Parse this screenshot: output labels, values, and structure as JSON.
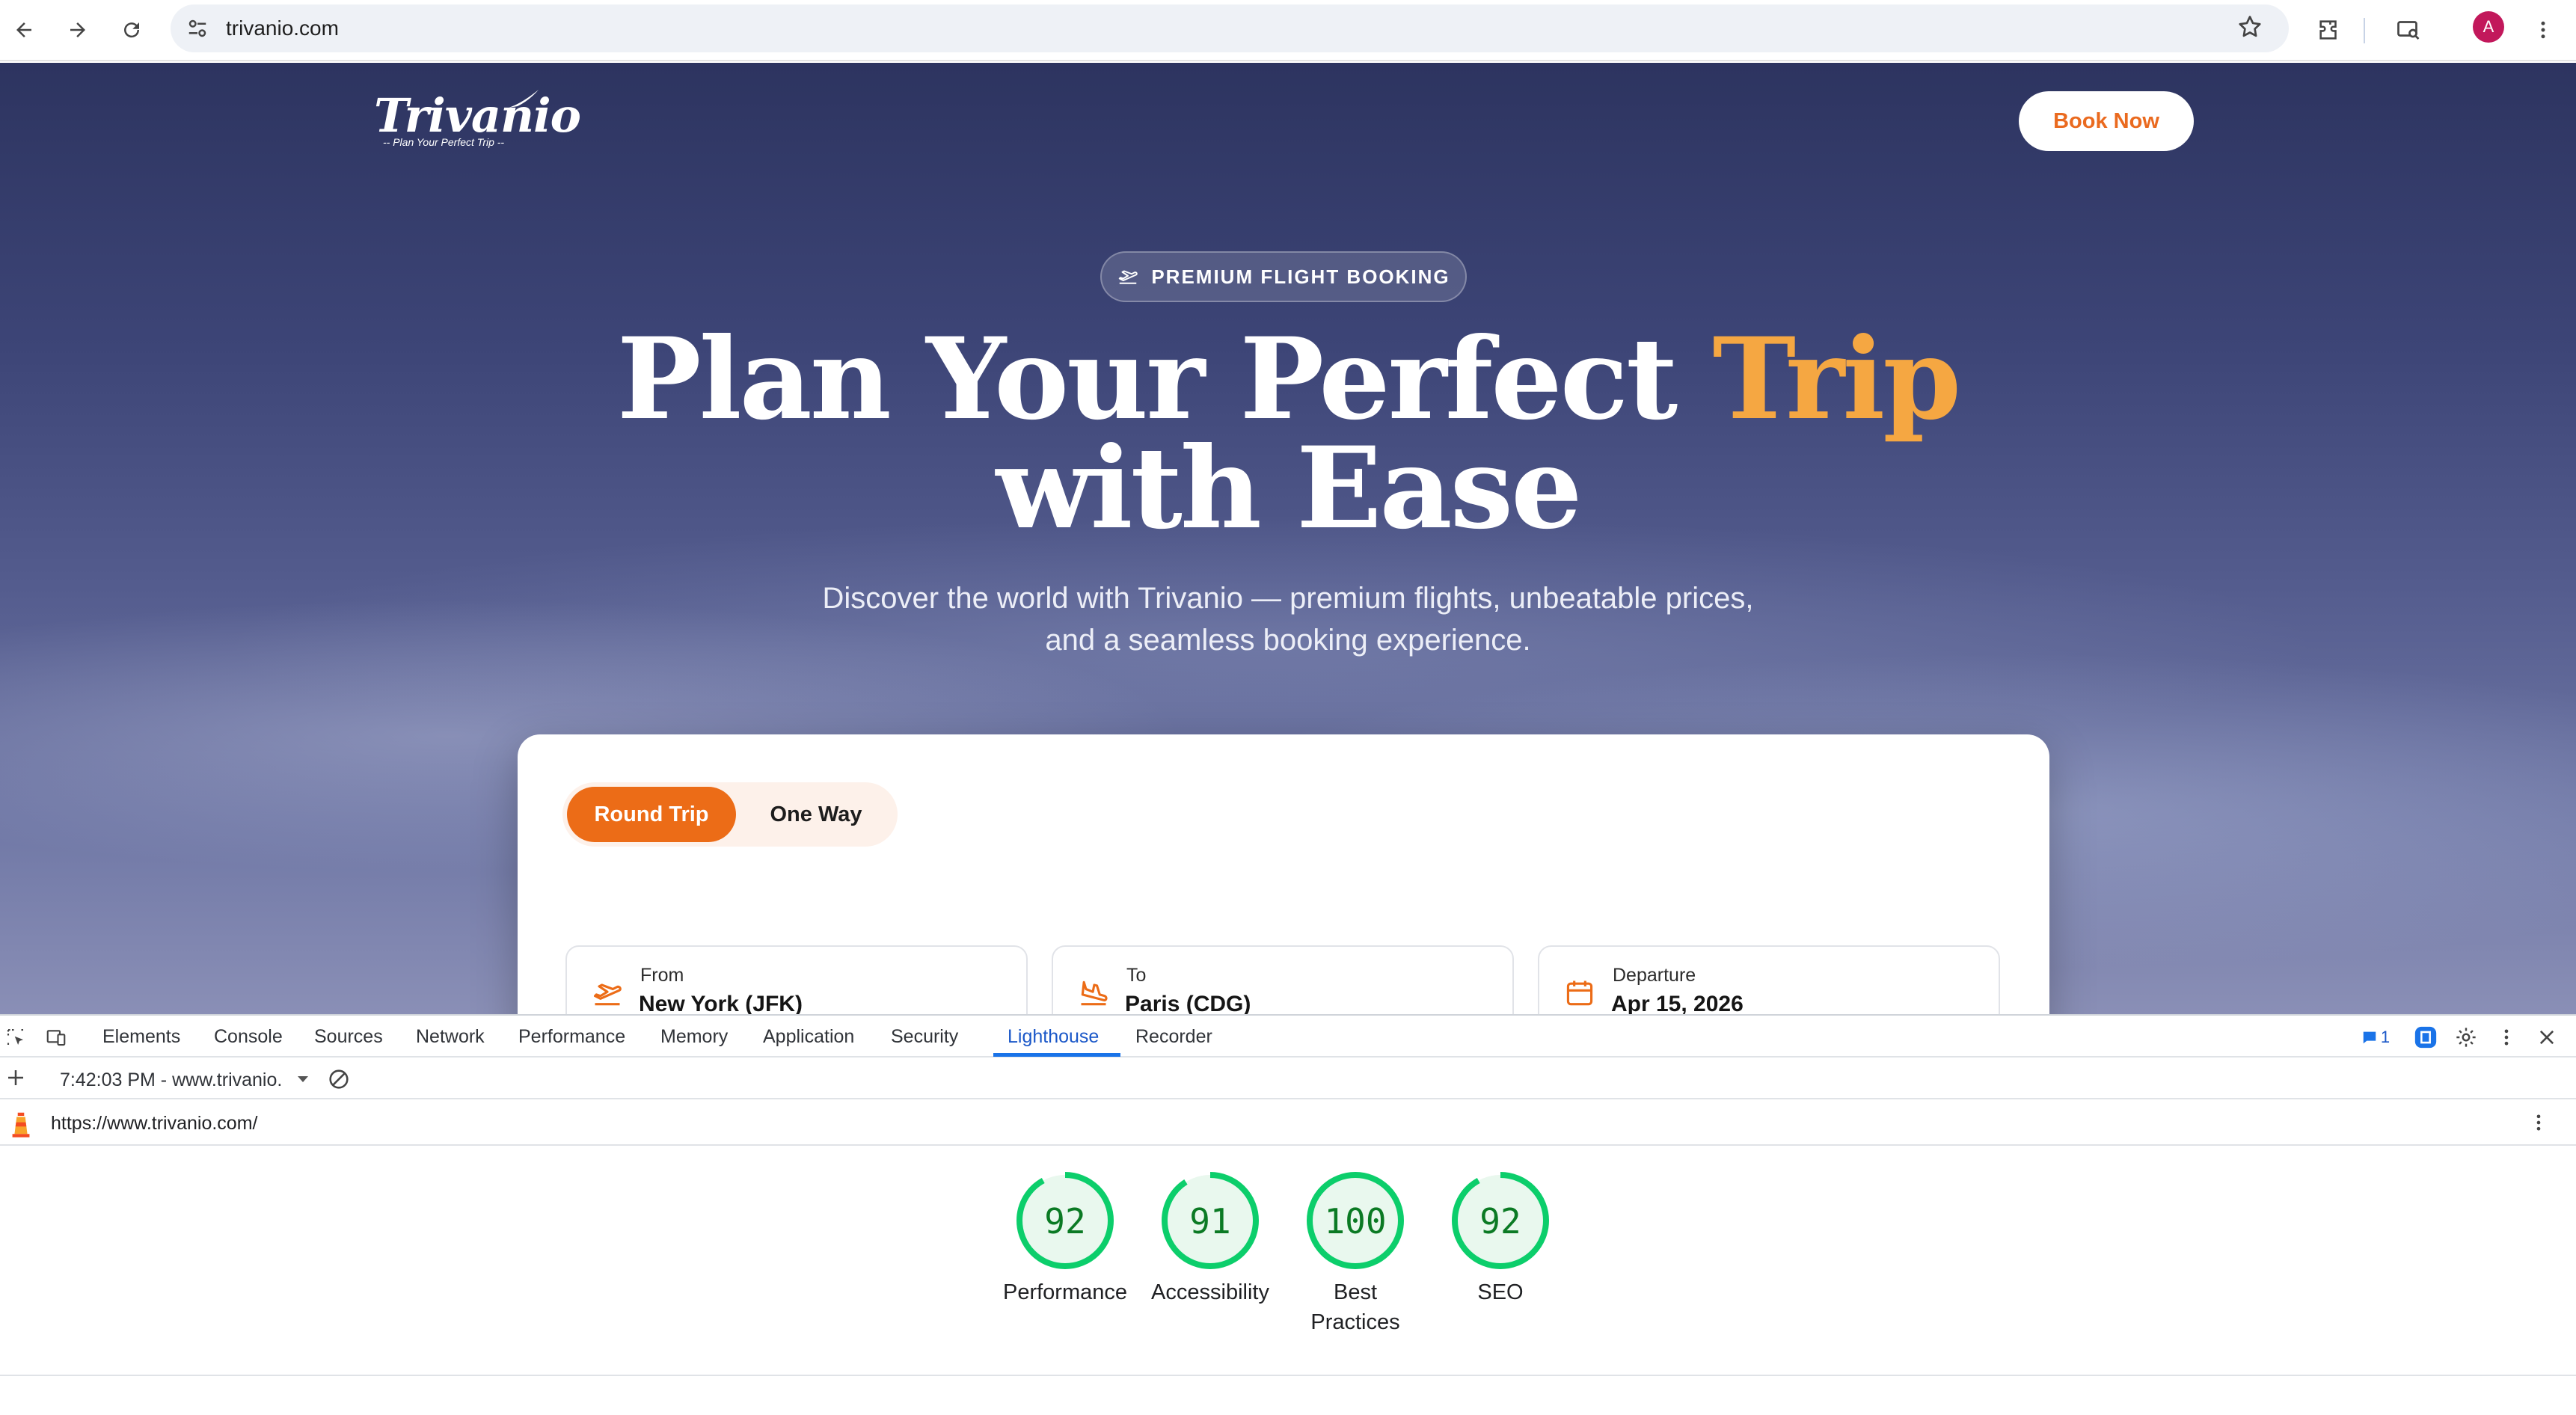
{
  "browser": {
    "url": "trivanio.com",
    "profile_initial": "A",
    "icons": [
      "back-icon",
      "forward-icon",
      "reload-icon",
      "site-info-icon",
      "star-icon",
      "extensions-icon",
      "lens-icon",
      "kebab-menu-icon"
    ]
  },
  "site": {
    "logo_text": "Trivanio",
    "logo_tagline": "-- Plan Your Perfect Trip --",
    "book_now": "Book Now",
    "badge": "PREMIUM FLIGHT BOOKING",
    "hero_line1": "Plan Your Perfect ",
    "hero_accent": "Trip",
    "hero_line2": "with Ease",
    "subtitle_line1": "Discover the world with Trivanio — premium flights, unbeatable prices,",
    "subtitle_line2": "and a seamless booking experience.",
    "search": {
      "trip_types": [
        "Round Trip",
        "One Way"
      ],
      "selected_trip_type": "Round Trip",
      "from": {
        "label": "From",
        "value": "New York (JFK)"
      },
      "to": {
        "label": "To",
        "value": "Paris (CDG)"
      },
      "departure": {
        "label": "Departure",
        "value": "Apr 15, 2026"
      }
    },
    "colors": {
      "accent_orange": "#ec6c17",
      "title_accent": "#f5a742"
    }
  },
  "devtools": {
    "tabs": [
      "Elements",
      "Console",
      "Sources",
      "Network",
      "Performance",
      "Memory",
      "Application",
      "Security",
      "Lighthouse",
      "Recorder"
    ],
    "active_tab": "Lighthouse",
    "issues_count": "1",
    "report_time": "7:42:03 PM - www.trivanio.",
    "report_url": "https://www.trivanio.com/",
    "scores": [
      {
        "label": "Performance",
        "value": "92",
        "fraction": 0.92
      },
      {
        "label": "Accessibility",
        "value": "91",
        "fraction": 0.91
      },
      {
        "label": "Best Practices",
        "value": "100",
        "fraction": 1.0
      },
      {
        "label": "SEO",
        "value": "92",
        "fraction": 0.92
      }
    ],
    "score_color": "#0cce6b"
  }
}
